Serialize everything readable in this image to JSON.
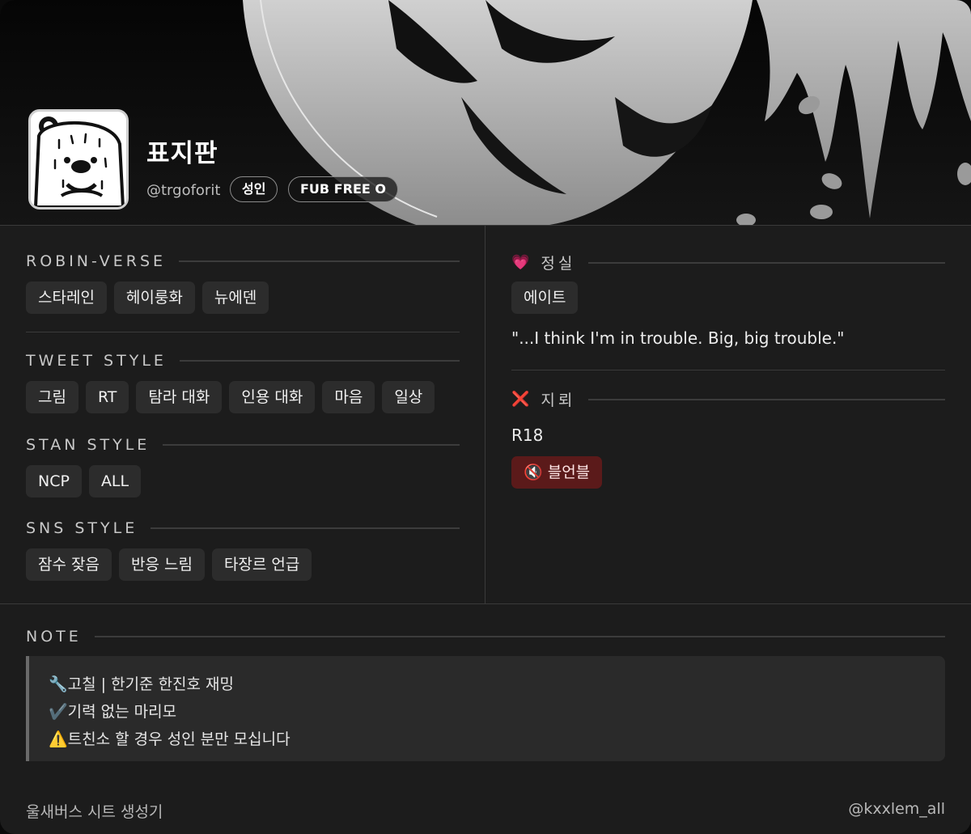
{
  "profile": {
    "name": "표지판",
    "handle": "@trgoforit",
    "badges": [
      "성인",
      "FUB FREE O"
    ]
  },
  "left": {
    "sections": [
      {
        "title": "ROBIN-VERSE",
        "tags": [
          "스타레인",
          "헤이룽화",
          "뉴에덴"
        ]
      },
      {
        "title": "TWEET STYLE",
        "tags": [
          "그림",
          "RT",
          "탐라 대화",
          "인용 대화",
          "마음",
          "일상"
        ]
      },
      {
        "title": "STAN STYLE",
        "tags": [
          "NCP",
          "ALL"
        ]
      },
      {
        "title": "SNS STYLE",
        "tags": [
          "잠수 잦음",
          "반응 느림",
          "타장르 언급"
        ]
      }
    ]
  },
  "right": {
    "favorite": {
      "icon": "💗",
      "title": "정실",
      "tag": "에이트",
      "quote": "\"...I think I'm in trouble. Big, big trouble.\""
    },
    "mine": {
      "icon": "❌",
      "title": "지뢰",
      "value": "R18",
      "alert_icon": "🔇",
      "alert_tag": "블언블"
    }
  },
  "note": {
    "title": "NOTE",
    "lines": [
      "🔧고칠 | 한기준 한진호 재밍",
      "✔️기력 없는 마리모",
      "⚠️트친소 할 경우 성인 분만 모십니다"
    ]
  },
  "footer": {
    "left": "울새버스 시트 생성기",
    "right": "@kxxlem_all"
  }
}
